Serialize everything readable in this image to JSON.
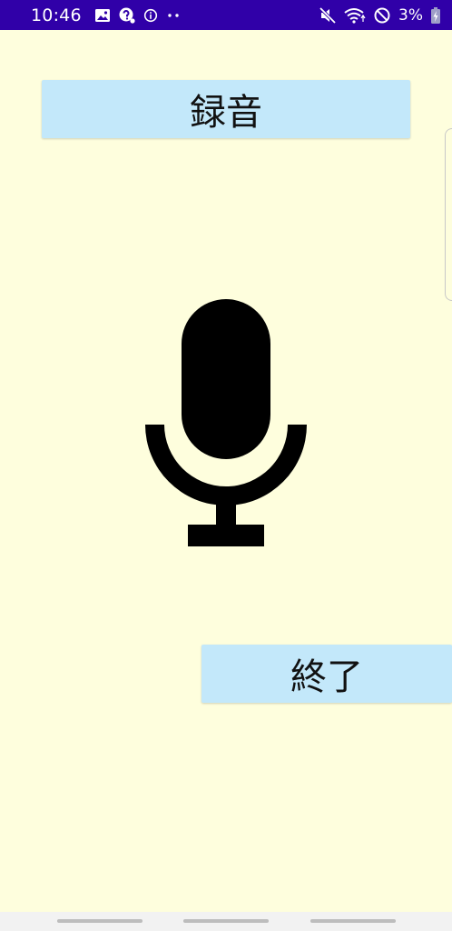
{
  "status_bar": {
    "time": "10:46",
    "battery_percent": "3%",
    "background_color": "#3000A8",
    "left_icons": [
      "image-icon",
      "assistant-icon",
      "info-icon",
      "more-dots-icon"
    ],
    "right_icons": [
      "mute-icon",
      "wifi-icon",
      "do-not-disturb-icon",
      "battery-charging-icon"
    ]
  },
  "app": {
    "background_color": "#FEFEDD",
    "button_color": "#C3E8FA",
    "record_button_label": "録音",
    "stop_button_label": "終了",
    "center_icon": "microphone-icon"
  },
  "nav_bar": {
    "pills": 3
  }
}
